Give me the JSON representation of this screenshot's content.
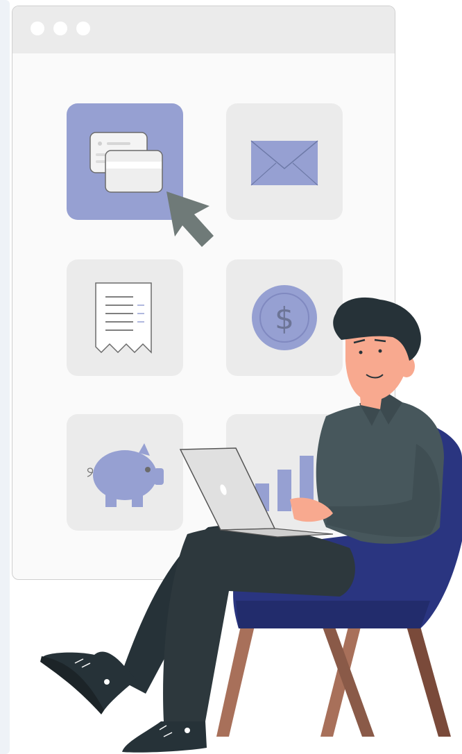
{
  "window": {
    "controls": [
      "window-dot-1",
      "window-dot-2",
      "window-dot-3"
    ]
  },
  "tiles": [
    {
      "icon": "payment-cards-icon",
      "selected": true
    },
    {
      "icon": "envelope-icon",
      "selected": false
    },
    {
      "icon": "receipt-icon",
      "selected": false
    },
    {
      "icon": "dollar-coin-icon",
      "selected": false
    },
    {
      "icon": "piggy-bank-icon",
      "selected": false
    },
    {
      "icon": "bar-chart-icon",
      "selected": false
    }
  ],
  "colors": {
    "accent": "#96a0d2",
    "tile": "#ebebeb",
    "window": "#fafafa",
    "titlebar": "#ebebeb",
    "cursor": "#6f7a78",
    "shirt": "#47575c",
    "pants": "#263238",
    "skin": "#f8a98f",
    "hair": "#263238",
    "chair": "#2a3580",
    "chair_legs": "#a8705a"
  },
  "illustration": {
    "subject": "man-using-laptop",
    "seat": "armchair"
  }
}
